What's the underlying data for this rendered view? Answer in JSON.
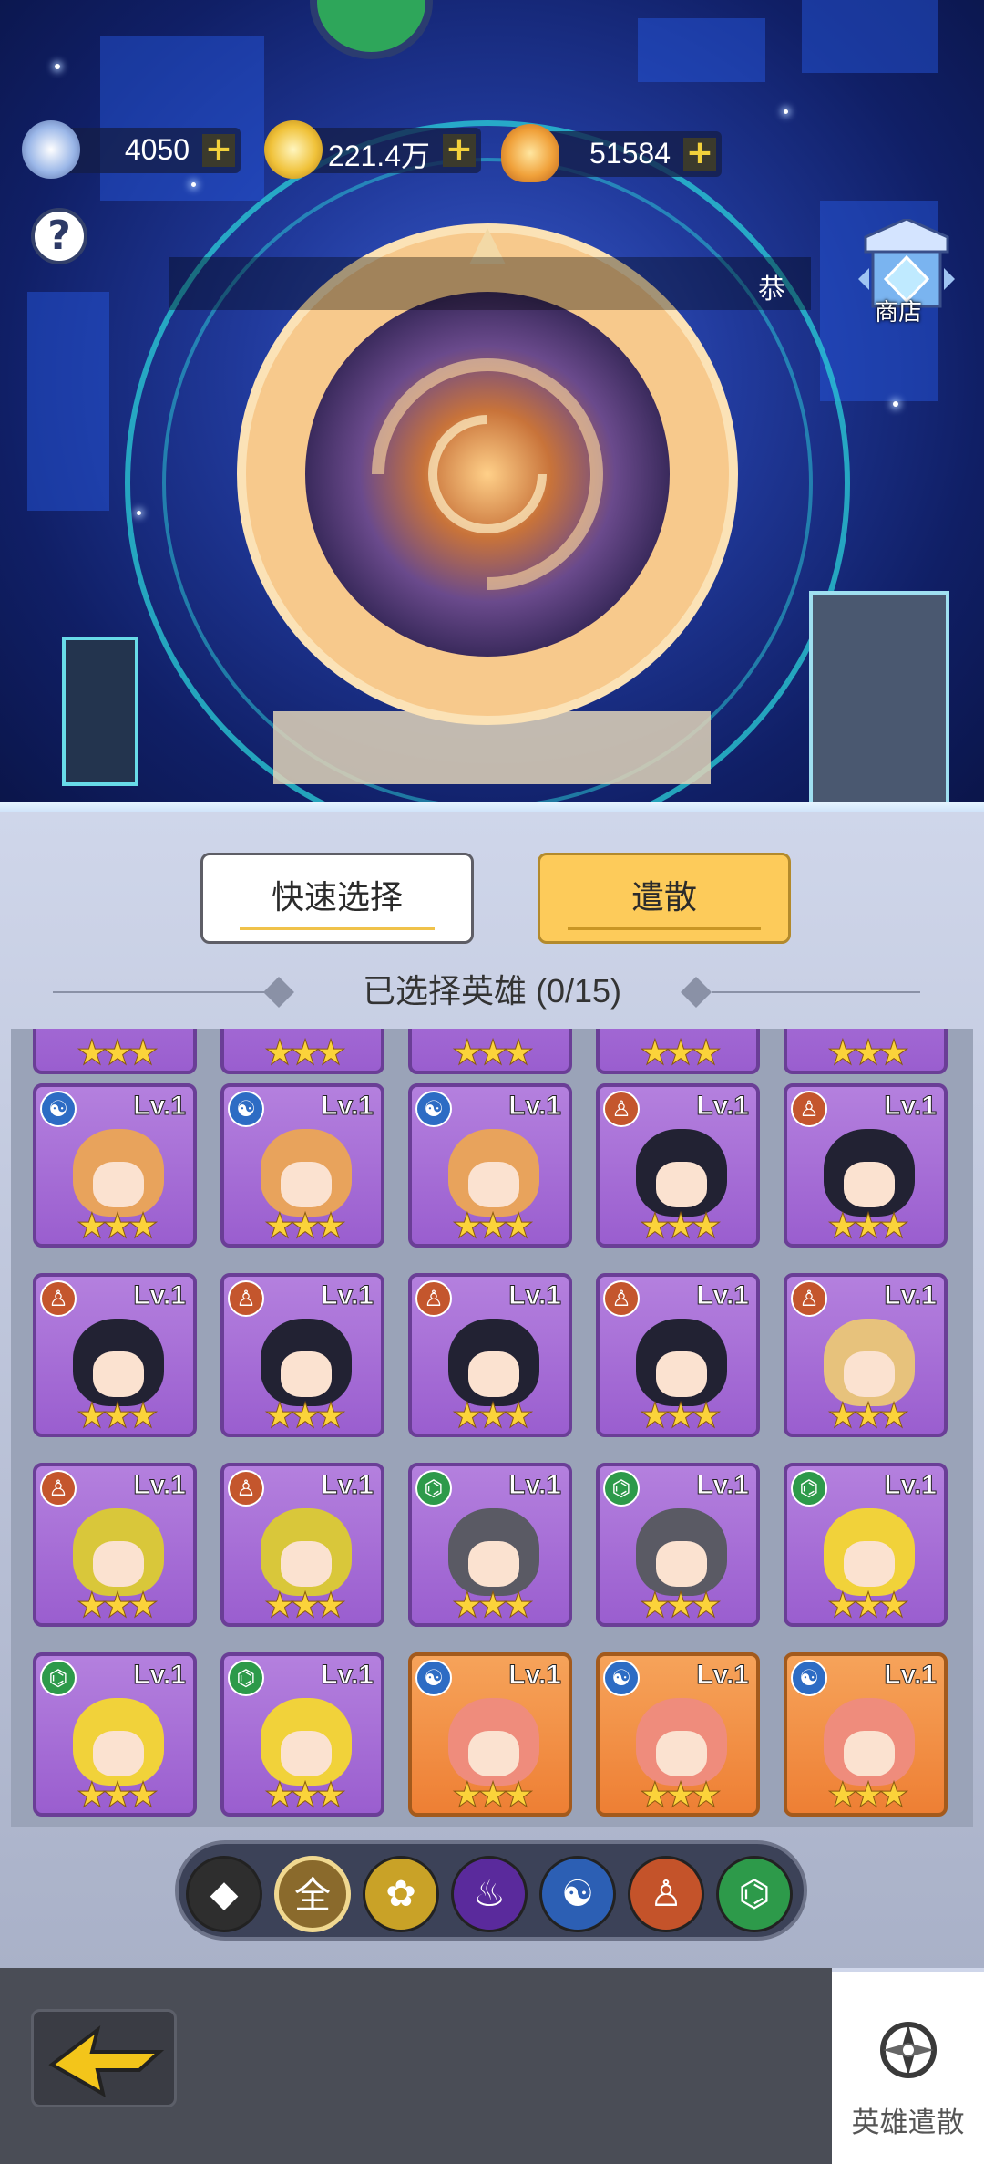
{
  "currencies": [
    {
      "icon": "gear-coin-icon",
      "value": "4050",
      "plus": "+"
    },
    {
      "icon": "gold-coin-icon",
      "value": "221.4万",
      "plus": "+"
    },
    {
      "icon": "flame-crystal-icon",
      "value": "51584",
      "plus": "+"
    }
  ],
  "help": {
    "label": "?"
  },
  "shop": {
    "label": "商店"
  },
  "banner": {
    "text": "恭"
  },
  "buttons": {
    "quick_select": "快速选择",
    "disband": "遣散"
  },
  "selection": {
    "label": "已选择英雄 (0/15)"
  },
  "level_label": "Lv.1",
  "stars": "★★★",
  "heroes": [
    {
      "element": "water",
      "hair": "#e8a35c",
      "color": "purple"
    },
    {
      "element": "water",
      "hair": "#e8a35c",
      "color": "purple"
    },
    {
      "element": "water",
      "hair": "#e8a35c",
      "color": "purple"
    },
    {
      "element": "body",
      "hair": "#222233",
      "color": "purple"
    },
    {
      "element": "body",
      "hair": "#222233",
      "color": "purple"
    },
    {
      "element": "body",
      "hair": "#222233",
      "color": "purple"
    },
    {
      "element": "body",
      "hair": "#222233",
      "color": "purple"
    },
    {
      "element": "body",
      "hair": "#222233",
      "color": "purple"
    },
    {
      "element": "body",
      "hair": "#222233",
      "color": "purple"
    },
    {
      "element": "body",
      "hair": "#e7c27c",
      "color": "purple"
    },
    {
      "element": "body",
      "hair": "#d9c73a",
      "color": "purple"
    },
    {
      "element": "body",
      "hair": "#d9c73a",
      "color": "purple"
    },
    {
      "element": "dna",
      "hair": "#5a5a64",
      "color": "purple"
    },
    {
      "element": "dna",
      "hair": "#5a5a64",
      "color": "purple"
    },
    {
      "element": "dna",
      "hair": "#f1d23a",
      "color": "purple"
    },
    {
      "element": "dna",
      "hair": "#f1d23a",
      "color": "purple"
    },
    {
      "element": "dna",
      "hair": "#f1d23a",
      "color": "purple"
    },
    {
      "element": "water",
      "hair": "#ef8c7c",
      "color": "orange"
    },
    {
      "element": "water",
      "hair": "#ef8c7c",
      "color": "orange"
    },
    {
      "element": "water",
      "hair": "#ef8c7c",
      "color": "orange"
    }
  ],
  "element_icons": {
    "water": "☯",
    "body": "♙",
    "dna": "⌬"
  },
  "element_colors": {
    "water": "#2d6cc4",
    "body": "#c4562d",
    "dna": "#2d9a4a"
  },
  "filters": [
    {
      "name": "filter-diamond-icon",
      "glyph": "◆",
      "bg": "#2e2e2e"
    },
    {
      "name": "filter-all-icon",
      "glyph": "全",
      "bg": "#8a6a2c"
    },
    {
      "name": "filter-lotus-icon",
      "glyph": "✿",
      "bg": "#c9a227"
    },
    {
      "name": "filter-flame-icon",
      "glyph": "♨",
      "bg": "#5a2a9c"
    },
    {
      "name": "filter-yinyang-icon",
      "glyph": "☯",
      "bg": "#2c5fb4"
    },
    {
      "name": "filter-meditate-icon",
      "glyph": "♙",
      "bg": "#c4532a"
    },
    {
      "name": "filter-dna-icon",
      "glyph": "⌬",
      "bg": "#2d9a4a"
    }
  ],
  "bottom_tab": {
    "label": "英雄遣散",
    "icon": "compass-icon"
  }
}
